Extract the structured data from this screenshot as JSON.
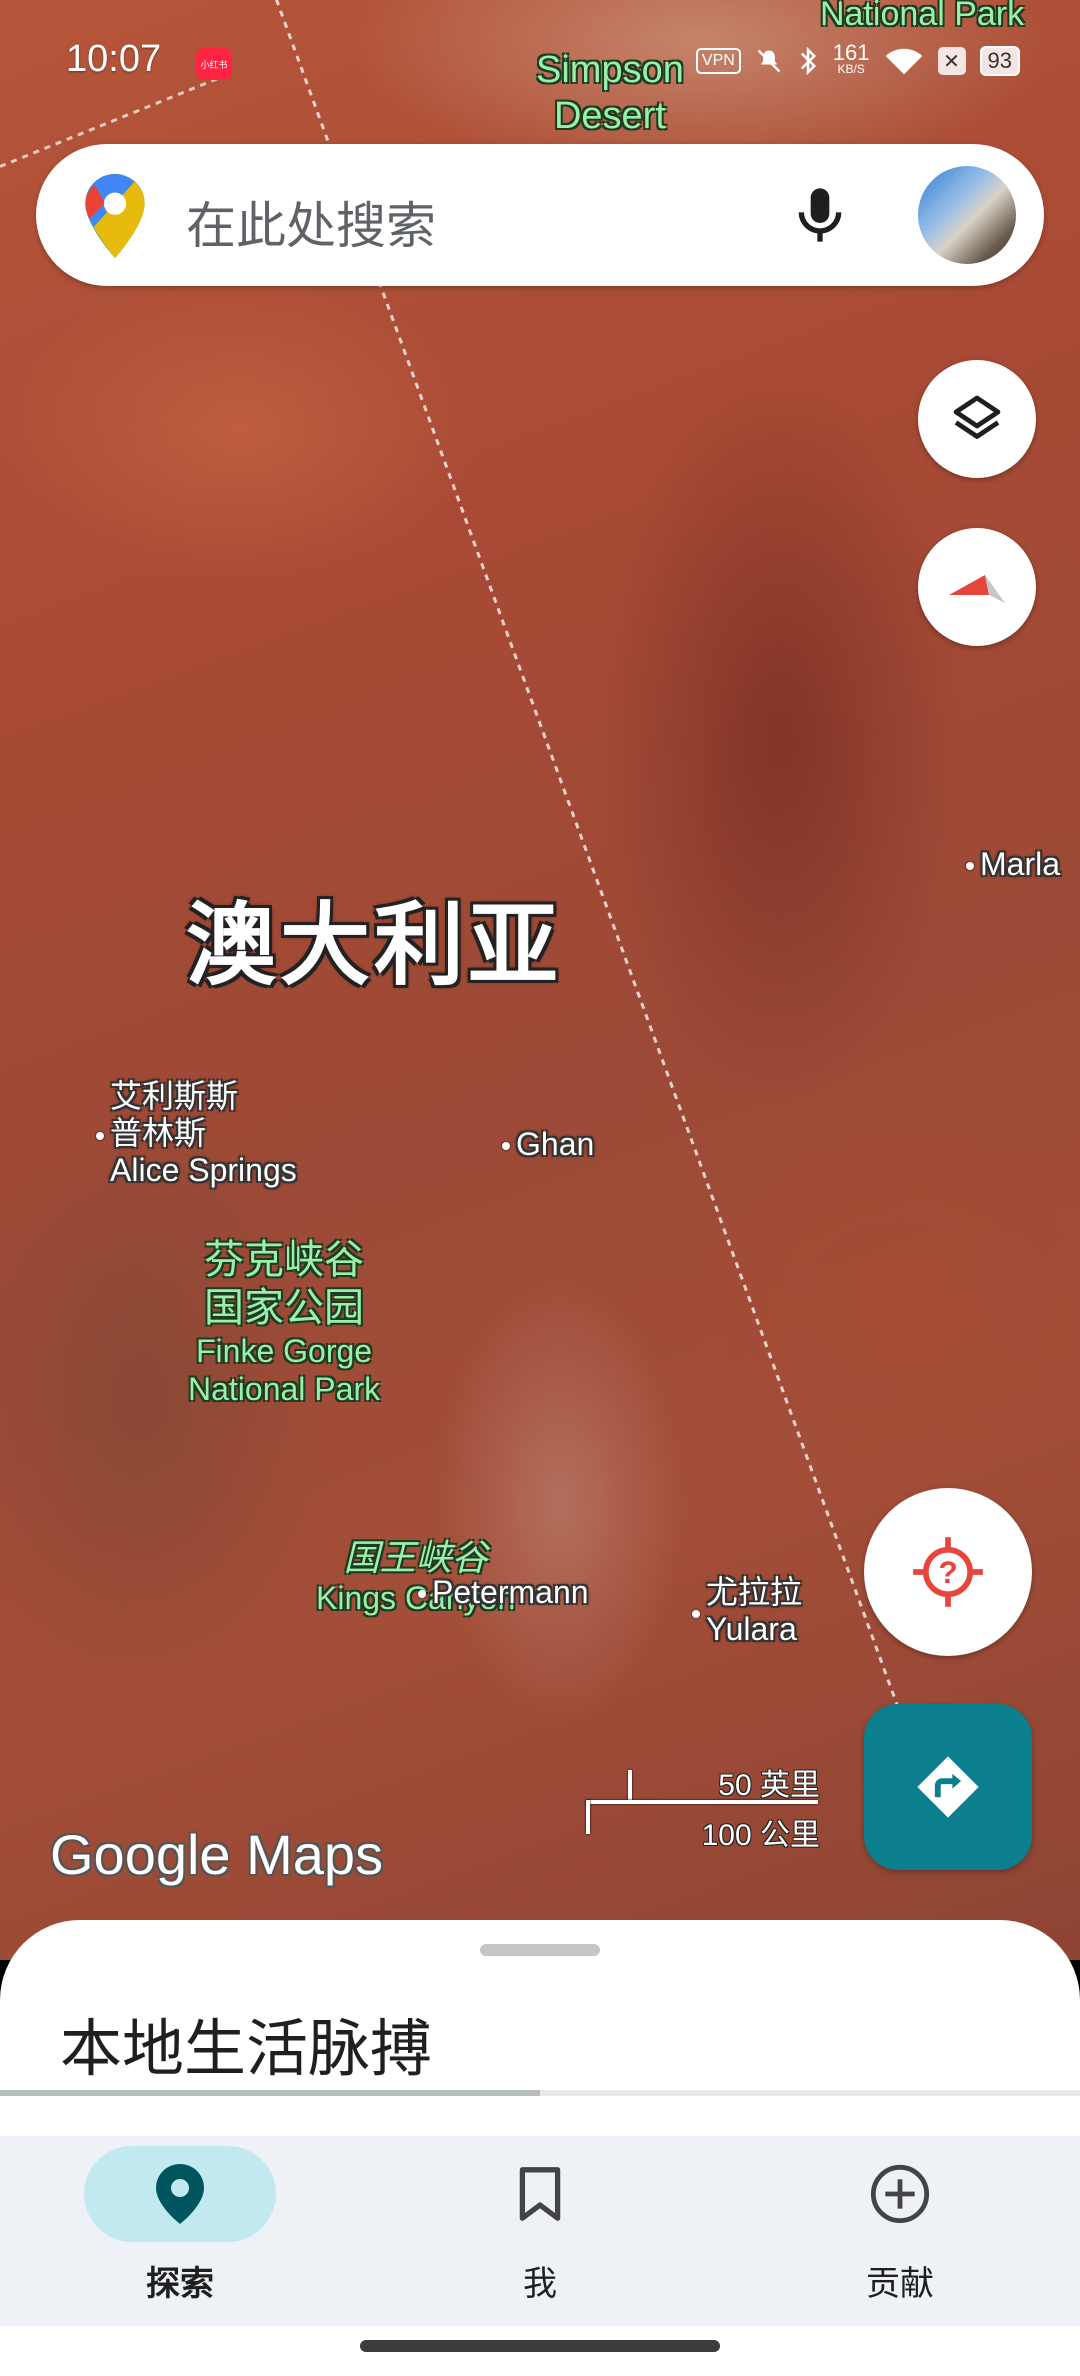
{
  "status_bar": {
    "time": "10:07",
    "app_badge": "小红书",
    "vpn": "VPN",
    "speed_value": "161",
    "speed_unit": "KB/S",
    "battery": "93"
  },
  "search": {
    "placeholder": "在此处搜索"
  },
  "icons": {
    "maps_logo": "google-maps-pin-icon",
    "mic": "microphone-icon",
    "layers": "layers-icon",
    "compass": "compass-icon",
    "location": "my-location-icon",
    "directions": "directions-icon",
    "explore": "location-pin-icon",
    "saved": "bookmark-icon",
    "contribute": "add-circle-icon"
  },
  "map": {
    "country": "澳大利亚",
    "labels": {
      "national_park_top": "National Park",
      "simpson_line1": "Simpson",
      "simpson_line2": "Desert",
      "marla": "Marla",
      "alice_cn1": "艾利斯斯",
      "alice_cn2": "普林斯",
      "alice_en": "Alice Springs",
      "ghan": "Ghan",
      "finke_cn1": "芬克峡谷",
      "finke_cn2": "国家公园",
      "finke_en1": "Finke Gorge",
      "finke_en2": "National Park",
      "kings_cn": "国王峡谷",
      "kings_en": "Kings Canyon",
      "petermann": "Petermann",
      "yulara_cn": "尤拉拉",
      "yulara_en": "Yulara"
    },
    "scale": {
      "top": "50 英里",
      "bottom": "100 公里"
    },
    "logo_text": "Google Maps"
  },
  "sheet": {
    "title": "本地生活脉搏",
    "progress": 0.5
  },
  "nav": {
    "explore": "探索",
    "saved": "我",
    "contribute": "贡献"
  },
  "colors": {
    "accent_teal": "#0b7f8e",
    "active_nav_bg": "#c2e8f0",
    "location_red": "#e8453c"
  }
}
